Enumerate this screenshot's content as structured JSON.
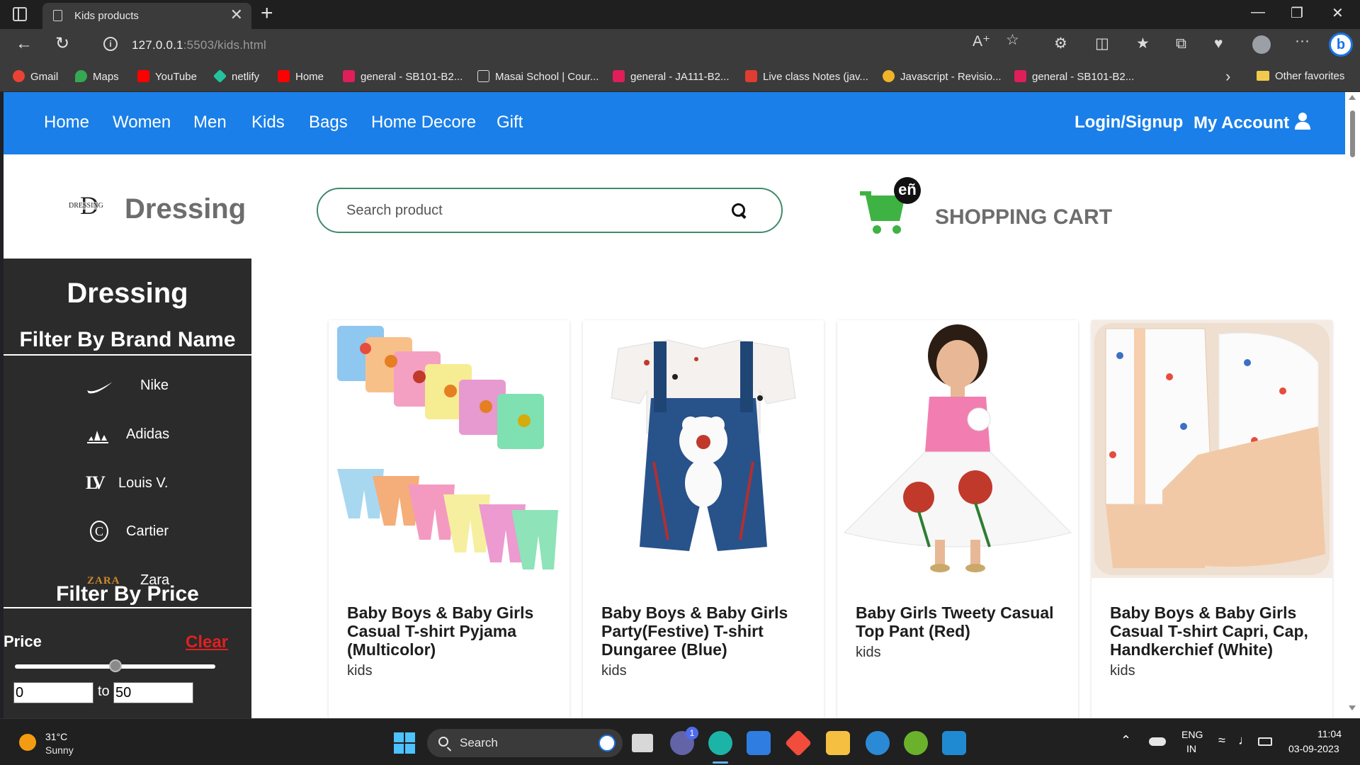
{
  "browser": {
    "tab_title": "Kids products",
    "tab_close": "✕",
    "new_tab": "+",
    "url_host": "127.0.0.1",
    "url_rest": ":5503/kids.html",
    "window_controls": [
      "—",
      "❐",
      "✕"
    ],
    "bookmarks": [
      {
        "label": "Gmail",
        "color": "#ea4335"
      },
      {
        "label": "Maps",
        "color": "#34a853"
      },
      {
        "label": "YouTube",
        "color": "#ff0000"
      },
      {
        "label": "netlify",
        "color": "#25c2a0"
      },
      {
        "label": "Home",
        "color": "#ff0000"
      },
      {
        "label": "general - SB101-B2...",
        "color": "#e01e5a"
      },
      {
        "label": "Masai School | Cour...",
        "color": "#dddddd"
      },
      {
        "label": "general - JA111-B2...",
        "color": "#e01e5a"
      },
      {
        "label": "Live class Notes (jav...",
        "color": "#e03c31"
      },
      {
        "label": "Javascript - Revisio...",
        "color": "#f0b429"
      },
      {
        "label": "general - SB101-B2...",
        "color": "#e01e5a"
      }
    ],
    "other_favorites": "Other favorites"
  },
  "site": {
    "nav": [
      "Home",
      "Women",
      "Men",
      "Kids",
      "Bags",
      "Home Decore",
      "Gift"
    ],
    "login": "Login/Signup",
    "account": "My Account",
    "brand_title": "Dressing",
    "logo_text": "DRESSING",
    "logo_letter": "D",
    "search_placeholder": "Search product",
    "cart_badge": "eñ",
    "cart_label": "SHOPPING CART",
    "accent_color": "#1a7fe8"
  },
  "sidebar": {
    "title": "Dressing",
    "brand_heading": "Filter By Brand Name",
    "brands": [
      {
        "name": "Nike",
        "icon": "nike-swoosh-icon"
      },
      {
        "name": "Adidas",
        "icon": "adidas-icon"
      },
      {
        "name": "Louis V.",
        "icon": "louis-vuitton-icon"
      },
      {
        "name": "Cartier",
        "icon": "cartier-icon"
      },
      {
        "name": "Zara",
        "icon": "zara-icon"
      }
    ],
    "zara_logo_text": "ZARA",
    "lv_logo_text": "LV",
    "cartier_logo_text": "C",
    "price_heading": "Filter By Price",
    "price_label": "Price",
    "clear_label": "Clear",
    "slider_position": 0.5,
    "min_value": "0",
    "to_label": "to",
    "max_value": "50"
  },
  "products": [
    {
      "name": "Baby Boys & Baby Girls Casual T-shirt Pyjama (Multicolor)",
      "category": "kids"
    },
    {
      "name": "Baby Boys & Baby Girls Party(Festive) T-shirt Dungaree (Blue)",
      "category": "kids"
    },
    {
      "name": "Baby Girls Tweety Casual Top Pant (Red)",
      "category": "kids"
    },
    {
      "name": "Baby Boys & Baby Girls Casual T-shirt Capri, Cap, Handkerchief (White)",
      "category": "kids"
    }
  ],
  "taskbar": {
    "temp": "31°C",
    "weather": "Sunny",
    "search_label": "Search",
    "chat_badge": "1",
    "lang_1": "ENG",
    "lang_2": "IN",
    "time": "11:04",
    "date": "03-09-2023"
  }
}
